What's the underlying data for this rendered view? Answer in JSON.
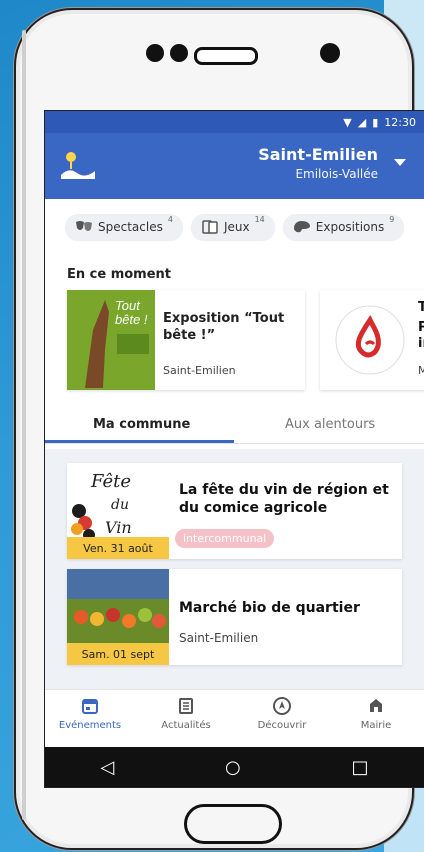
{
  "status": {
    "time": "12:30"
  },
  "header": {
    "city": "Saint-Emilien",
    "subtitle": "Emilois-Vallée"
  },
  "chips": [
    {
      "label": "Spectacles",
      "count": "4",
      "icon": "masks-icon"
    },
    {
      "label": "Jeux",
      "count": "14",
      "icon": "cards-icon"
    },
    {
      "label": "Expositions",
      "count": "9",
      "icon": "palette-icon"
    }
  ],
  "moments": {
    "title": "En ce moment",
    "items": [
      {
        "title": "Exposition “Tout bête !”",
        "location": "Saint-Emilien",
        "poster": [
          "Tout",
          "bête !"
        ]
      },
      {
        "title": "T",
        "subtitle": "P",
        "extra": "in",
        "location": "M",
        "logo": "Don du Sang"
      }
    ]
  },
  "tabs": {
    "active": "Ma commune",
    "inactive": "Aux alentours"
  },
  "events": [
    {
      "title": "La fête du vin de région et du comice agricole",
      "tag": "intercommunal",
      "date": "Ven. 31 août"
    },
    {
      "title": "Marché bio de quartier",
      "location": "Saint-Emilien",
      "date": "Sam. 01 sept"
    }
  ],
  "nav": [
    {
      "label": "Evénements",
      "icon": "calendar-icon",
      "active": true
    },
    {
      "label": "Actualités",
      "icon": "news-icon"
    },
    {
      "label": "Découvrir",
      "icon": "compass-icon"
    },
    {
      "label": "Mairie",
      "icon": "townhall-icon"
    }
  ],
  "colors": {
    "primary": "#3a66c4",
    "statusbar": "#2f59b6",
    "badge": "#f5c742",
    "tag": "#f4c1c7"
  }
}
